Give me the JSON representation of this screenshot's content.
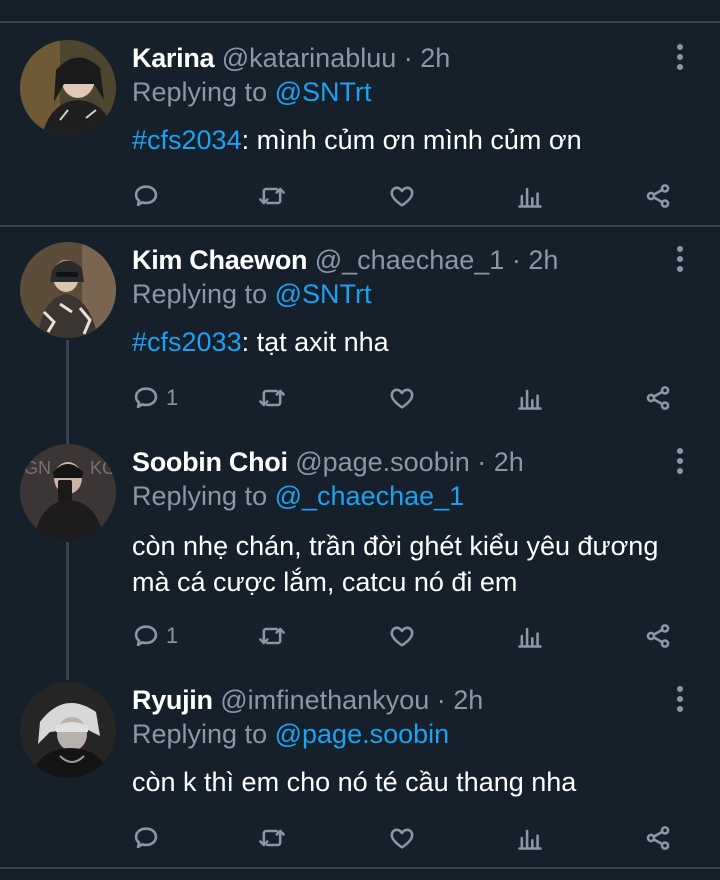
{
  "tweets": [
    {
      "name": "Karina",
      "handle": "@katarinabluu",
      "time": "· 2h",
      "reply_label": "Replying to",
      "reply_to": "@SNTrt",
      "hashtag": "#cfs2034",
      "text": ": mình củm ơn mình củm ơn",
      "reply_count": "",
      "avatar_colors": {
        "bg": "#5a4a2a",
        "fg": "#1a1a1a"
      }
    },
    {
      "name": "Kim Chaewon",
      "handle": "@_chaechae_1",
      "time": "· 2h",
      "reply_label": "Replying to",
      "reply_to": "@SNTrt",
      "hashtag": "#cfs2033",
      "text": ": tạt axit nha",
      "reply_count": "1",
      "avatar_colors": {
        "bg": "#6b5a44",
        "fg": "#2b2b2b"
      }
    },
    {
      "name": "Soobin Choi",
      "handle": "@page.soobin",
      "time": "· 2h",
      "reply_label": "Replying to",
      "reply_to": "@_chaechae_1",
      "hashtag": "",
      "text": "còn nhẹ chán, trần đời ghét kiểu yêu đương mà cá cược lắm, catcu nó đi em",
      "reply_count": "1",
      "avatar_colors": {
        "bg": "#3b3536",
        "fg": "#1c1c1c"
      }
    },
    {
      "name": "Ryujin",
      "handle": "@imfinethankyou",
      "time": "· 2h",
      "reply_label": "Replying to",
      "reply_to": "@page.soobin",
      "hashtag": "",
      "text": "còn k thì em cho nó té cầu thang nha",
      "reply_count": "",
      "avatar_colors": {
        "bg": "#2a2a2a",
        "fg": "#8a8a8a"
      }
    }
  ],
  "icons": [
    "reply-icon",
    "retweet-icon",
    "like-icon",
    "analytics-icon",
    "share-icon",
    "more-options-icon"
  ],
  "colors": {
    "background": "#15202b",
    "divider": "#38444d",
    "secondary": "#8899a6",
    "accent": "#1da1f2"
  }
}
